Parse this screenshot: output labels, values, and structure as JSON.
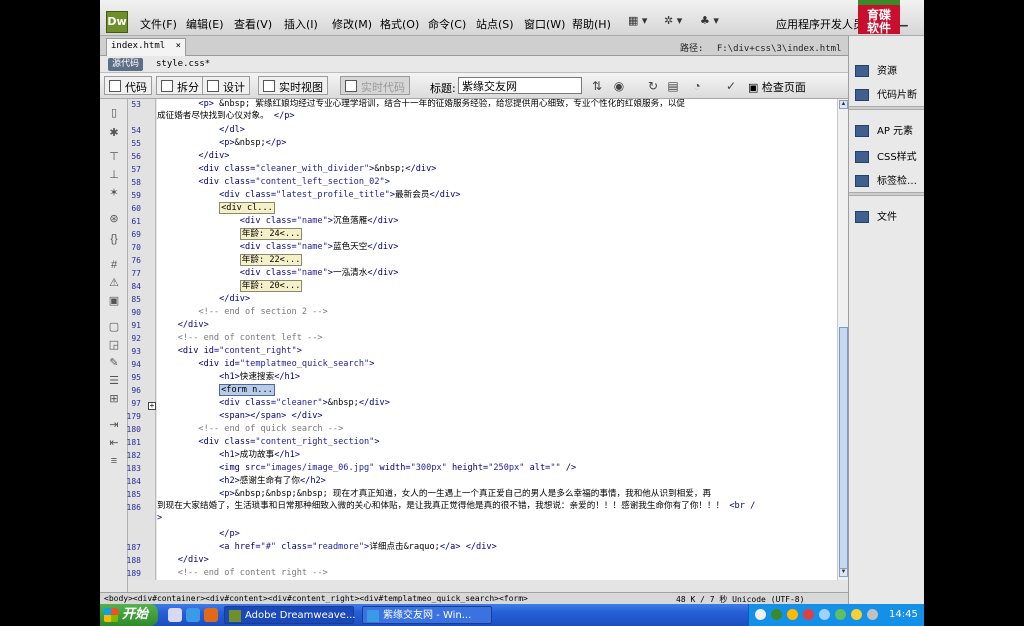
{
  "menu": {
    "logo": "Dw",
    "items": [
      "文件(F)",
      "编辑(E)",
      "查看(V)",
      "插入(I)",
      "修改(M)",
      "格式(O)",
      "命令(C)",
      "站点(S)",
      "窗口(W)",
      "帮助(H)"
    ],
    "workspace": "应用程序开发人员",
    "brand_logo_top": "育碟",
    "brand_logo_bottom": "软件"
  },
  "doc": {
    "tab": "index.html",
    "tab_close": "×",
    "path_label": "路径:",
    "path": "F:\\div+css\\3\\index.html",
    "source_button": "源代码",
    "related_file": "style.css*"
  },
  "toolbar": {
    "code": "代码",
    "split": "拆分",
    "design": "设计",
    "live_view": "实时视图",
    "live_code": "实时代码",
    "title_label": "标题:",
    "title_value": "紫缘交友网",
    "check_page": "检查页面"
  },
  "line_numbers": [
    "53",
    "",
    "54",
    "55",
    "56",
    "57",
    "58",
    "59",
    "60",
    "61",
    "69",
    "70",
    "76",
    "77",
    "84",
    "85",
    "90",
    "91",
    "92",
    "93",
    "94",
    "95",
    "96",
    "97",
    "179",
    "180",
    "181",
    "182",
    "183",
    "184",
    "185",
    "186",
    "",
    "",
    "187",
    "188",
    "189",
    "190"
  ],
  "status": {
    "tag_selector": "<body><div#container><div#content><div#content_right><div#templatmeo_quick_search><form>",
    "info": "48 K / 7 秒  Unicode (UTF-8)"
  },
  "right_panel": {
    "items": [
      "资源",
      "代码片断",
      "AP 元素",
      "CSS样式",
      "标签检…",
      "文件"
    ]
  },
  "taskbar": {
    "start": "开始",
    "tasks": [
      "Adobe Dreamweave...",
      "紫缘交友网 - Win..."
    ],
    "clock": "14:45"
  }
}
